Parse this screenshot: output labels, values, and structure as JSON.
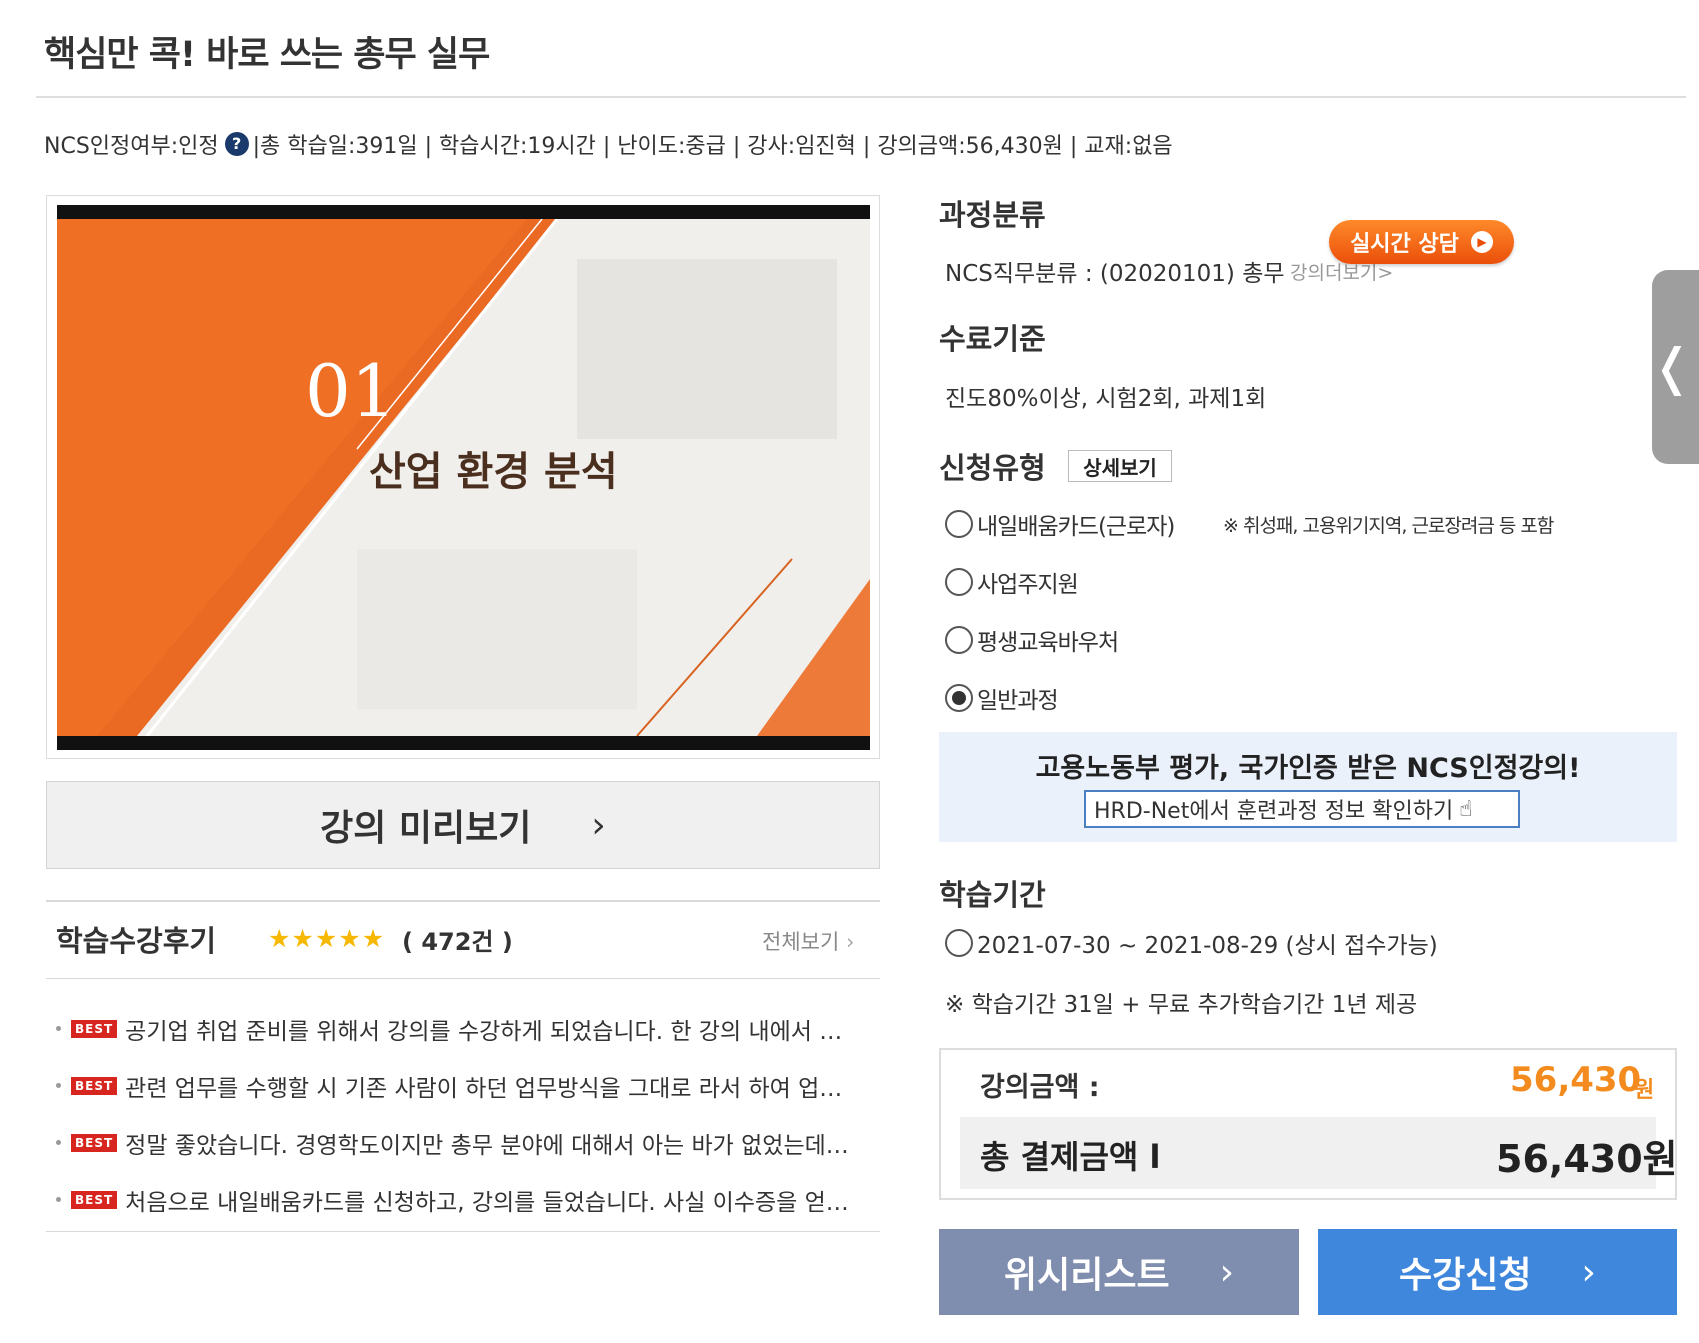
{
  "course": {
    "title": "핵심만 콕! 바로 쓰는 총무 실무",
    "meta_left": "NCS인정여부:인정",
    "meta_right": "|총 학습일:391일 | 학습시간:19시간 | 난이도:중급 | 강사:임진혁 | 강의금액:56,430원 | 교재:없음"
  },
  "video": {
    "number": "01",
    "slide_title": "산업 환경 분석"
  },
  "preview": {
    "label": "강의 미리보기"
  },
  "reviews": {
    "heading": "학습수강후기",
    "rating_stars": 5,
    "count": "( 472건 )",
    "view_all": "전체보기",
    "badge": "BEST",
    "items": [
      "공기업 취업 준비를 위해서 강의를 수강하게 되었습니다. 한 강의 내에서 …",
      "관련 업무를 수행할 시 기존 사람이 하던 업무방식을 그대로 라서 하여 업…",
      "정말 좋았습니다. 경영학도이지만 총무 분야에 대해서 아는 바가 없었는데…",
      "처음으로 내일배움카드를 신청하고, 강의를 들었습니다. 사실 이수증을 얻…"
    ]
  },
  "classification": {
    "heading": "과정분류",
    "text": "NCS직무분류 : (02020101) 총무",
    "more": "강의더보기>",
    "consult_label": "실시간 상담"
  },
  "completion": {
    "heading": "수료기준",
    "text": "진도80%이상, 시험2회, 과제1회"
  },
  "apply_type": {
    "heading": "신청유형",
    "detail_label": "상세보기",
    "note": "※ 취성패, 고용위기지역, 근로장려금 등 포함",
    "options": [
      {
        "label": "내일배움카드(근로자)",
        "selected": false
      },
      {
        "label": "사업주지원",
        "selected": false
      },
      {
        "label": "평생교육바우처",
        "selected": false
      },
      {
        "label": "일반과정",
        "selected": true
      }
    ]
  },
  "ncs_banner": {
    "headline": "고용노동부 평가, 국가인증 받은 NCS인정강의!",
    "link": "HRD-Net에서 훈련과정 정보 확인하기"
  },
  "period": {
    "heading": "학습기간",
    "option": "2021-07-30 ~ 2021-08-29 (상시 접수가능)",
    "note": "※ 학습기간 31일 + 무료 추가학습기간 1년 제공"
  },
  "price": {
    "label": "강의금액 :",
    "value": "56,430",
    "won": "원",
    "total_label": "총 결제금액 l",
    "total_value": "56,430원"
  },
  "actions": {
    "wishlist": "위시리스트",
    "apply": "수강신청"
  },
  "colors": {
    "accent_orange": "#f38b1e",
    "apply_blue": "#3f86dd",
    "wish_gray_blue": "#7f8eae",
    "best_red": "#d7261f"
  }
}
